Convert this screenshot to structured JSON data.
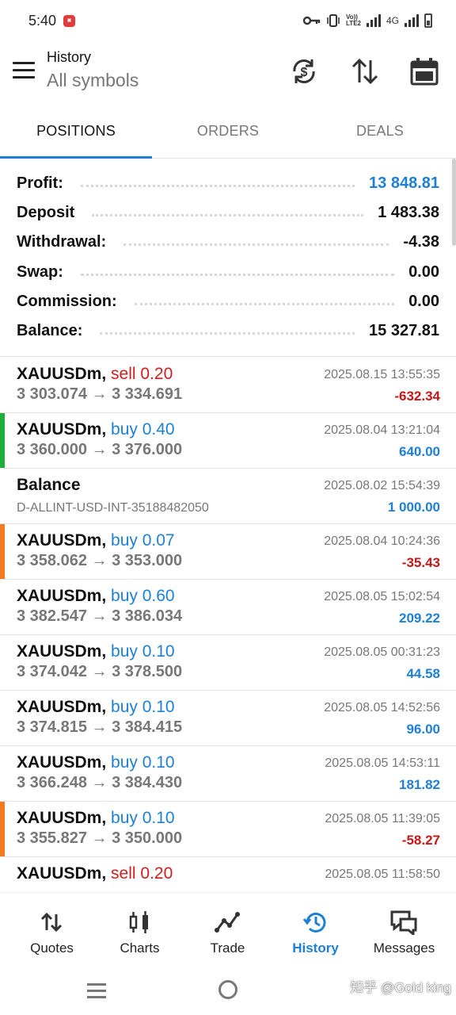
{
  "status_bar": {
    "time": "5:40",
    "badge_icon": "app-notification-icon",
    "volte": "Vo)) LTE2",
    "network": "4G"
  },
  "app_bar": {
    "title": "History",
    "subtitle": "All symbols",
    "icons": [
      "menu-icon",
      "refresh-dollar-icon",
      "sort-icon",
      "calendar-icon"
    ]
  },
  "tabs": [
    {
      "label": "POSITIONS",
      "active": true
    },
    {
      "label": "ORDERS",
      "active": false
    },
    {
      "label": "DEALS",
      "active": false
    }
  ],
  "summary": {
    "profit": {
      "label": "Profit:",
      "value": "13 848.81"
    },
    "deposit": {
      "label": "Deposit",
      "value": "1 483.38"
    },
    "withdrawal": {
      "label": "Withdrawal:",
      "value": "-4.38"
    },
    "swap": {
      "label": "Swap:",
      "value": "0.00"
    },
    "commission": {
      "label": "Commission:",
      "value": "0.00"
    },
    "balance": {
      "label": "Balance:",
      "value": "15 327.81"
    }
  },
  "rows": [
    {
      "symbol": "XAUUSDm,",
      "side": "sell 0.20",
      "prices": "3 303.074 → 3 334.691",
      "time": "2025.08.15 13:55:35",
      "profit": "-632.34"
    },
    {
      "symbol": "XAUUSDm,",
      "side": "buy 0.40",
      "prices": "3 360.000 → 3 376.000",
      "time": "2025.08.04 13:21:04",
      "profit": "640.00"
    },
    {
      "symbol": "Balance",
      "side": "",
      "prices": "D-ALLINT-USD-INT-35188482050",
      "time": "2025.08.02 15:54:39",
      "profit": "1 000.00"
    },
    {
      "symbol": "XAUUSDm,",
      "side": "buy 0.07",
      "prices": "3 358.062 → 3 353.000",
      "time": "2025.08.04 10:24:36",
      "profit": "-35.43"
    },
    {
      "symbol": "XAUUSDm,",
      "side": "buy 0.60",
      "prices": "3 382.547 → 3 386.034",
      "time": "2025.08.05 15:02:54",
      "profit": "209.22"
    },
    {
      "symbol": "XAUUSDm,",
      "side": "buy 0.10",
      "prices": "3 374.042 → 3 378.500",
      "time": "2025.08.05 00:31:23",
      "profit": "44.58"
    },
    {
      "symbol": "XAUUSDm,",
      "side": "buy 0.10",
      "prices": "3 374.815 → 3 384.415",
      "time": "2025.08.05 14:52:56",
      "profit": "96.00"
    },
    {
      "symbol": "XAUUSDm,",
      "side": "buy 0.10",
      "prices": "3 366.248 → 3 384.430",
      "time": "2025.08.05 14:53:11",
      "profit": "181.82"
    },
    {
      "symbol": "XAUUSDm,",
      "side": "buy 0.10",
      "prices": "3 355.827 → 3 350.000",
      "time": "2025.08.05 11:39:05",
      "profit": "-58.27"
    },
    {
      "symbol": "XAUUSDm,",
      "side": "sell 0.20",
      "prices": "",
      "time": "2025.08.05 11:58:50",
      "profit": ""
    }
  ],
  "bottom_nav": [
    {
      "label": "Quotes",
      "icon": "quotes-icon"
    },
    {
      "label": "Charts",
      "icon": "charts-icon"
    },
    {
      "label": "Trade",
      "icon": "trade-icon"
    },
    {
      "label": "History",
      "icon": "history-icon",
      "active": true
    },
    {
      "label": "Messages",
      "icon": "messages-icon"
    }
  ],
  "watermark": "知乎 @Gold king",
  "colors": {
    "accent": "#1e7fd6",
    "loss": "#c41818",
    "sell": "#d01d1d",
    "marker_green": "#1fae3c",
    "marker_orange": "#f47a1f"
  }
}
